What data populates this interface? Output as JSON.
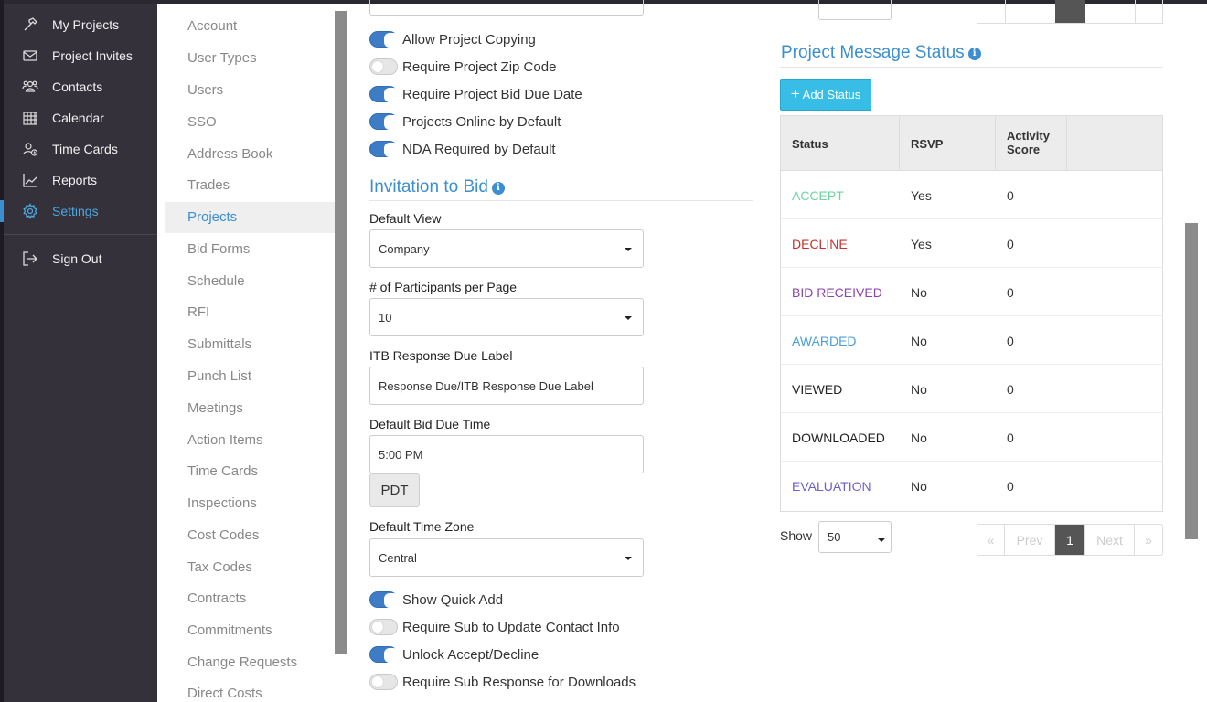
{
  "nav": {
    "items": [
      {
        "label": "My Projects",
        "icon": "hammer-icon"
      },
      {
        "label": "Project Invites",
        "icon": "envelope-icon"
      },
      {
        "label": "Contacts",
        "icon": "contacts-icon"
      },
      {
        "label": "Calendar",
        "icon": "calendar-icon"
      },
      {
        "label": "Time Cards",
        "icon": "time-card-icon"
      },
      {
        "label": "Reports",
        "icon": "chart-line-icon"
      },
      {
        "label": "Settings",
        "icon": "gear-icon"
      }
    ],
    "sign_out": "Sign Out",
    "active_color": "#4da8e0"
  },
  "submenu": {
    "items": [
      "Account",
      "User Types",
      "Users",
      "SSO",
      "Address Book",
      "Trades",
      "Projects",
      "Bid Forms",
      "Schedule",
      "RFI",
      "Submittals",
      "Punch List",
      "Meetings",
      "Action Items",
      "Time Cards",
      "Inspections",
      "Cost Codes",
      "Tax Codes",
      "Contracts",
      "Commitments",
      "Change Requests",
      "Direct Costs"
    ],
    "active": "Projects"
  },
  "form": {
    "toggles_top": [
      {
        "label": "Allow Project Copying",
        "on": true
      },
      {
        "label": "Require Project Zip Code",
        "on": false
      },
      {
        "label": "Require Project Bid Due Date",
        "on": true
      },
      {
        "label": "Projects Online by Default",
        "on": true
      },
      {
        "label": "NDA Required by Default",
        "on": true
      }
    ],
    "itb_title": "Invitation to Bid",
    "default_view_label": "Default View",
    "default_view_value": "Company",
    "participants_label": "# of Participants per Page",
    "participants_value": "10",
    "itb_due_label": "ITB Response Due Label",
    "itb_due_value": "Response Due/ITB Response Due Label",
    "bid_time_label": "Default Bid Due Time",
    "bid_time_value": "5:00 PM",
    "tz_addon": "PDT",
    "timezone_label": "Default Time Zone",
    "timezone_value": "Central",
    "toggles_bottom": [
      {
        "label": "Show Quick Add",
        "on": true
      },
      {
        "label": "Require Sub to Update Contact Info",
        "on": false
      },
      {
        "label": "Unlock Accept/Decline",
        "on": true
      },
      {
        "label": "Require Sub Response for Downloads",
        "on": false
      }
    ]
  },
  "status_panel": {
    "title": "Project Message Status",
    "add_button": "Add Status",
    "columns": [
      "Status",
      "RSVP",
      "",
      "Activity Score"
    ],
    "rows": [
      {
        "status": "ACCEPT",
        "rsvp": "Yes",
        "score": "0",
        "color": "#6fd3a0"
      },
      {
        "status": "DECLINE",
        "rsvp": "Yes",
        "score": "0",
        "color": "#c9302c"
      },
      {
        "status": "BID RECEIVED",
        "rsvp": "No",
        "score": "0",
        "color": "#8e44ad"
      },
      {
        "status": "AWARDED",
        "rsvp": "No",
        "score": "0",
        "color": "#4a9fd8"
      },
      {
        "status": "VIEWED",
        "rsvp": "No",
        "score": "0",
        "color": "#222222"
      },
      {
        "status": "DOWNLOADED",
        "rsvp": "No",
        "score": "0",
        "color": "#222222"
      },
      {
        "status": "EVALUATION",
        "rsvp": "No",
        "score": "0",
        "color": "#6c5fc7"
      }
    ],
    "show_label": "Show",
    "show_value": "50",
    "pager": {
      "first": "«",
      "prev": "Prev",
      "page": "1",
      "next": "Next",
      "last": "»"
    }
  }
}
